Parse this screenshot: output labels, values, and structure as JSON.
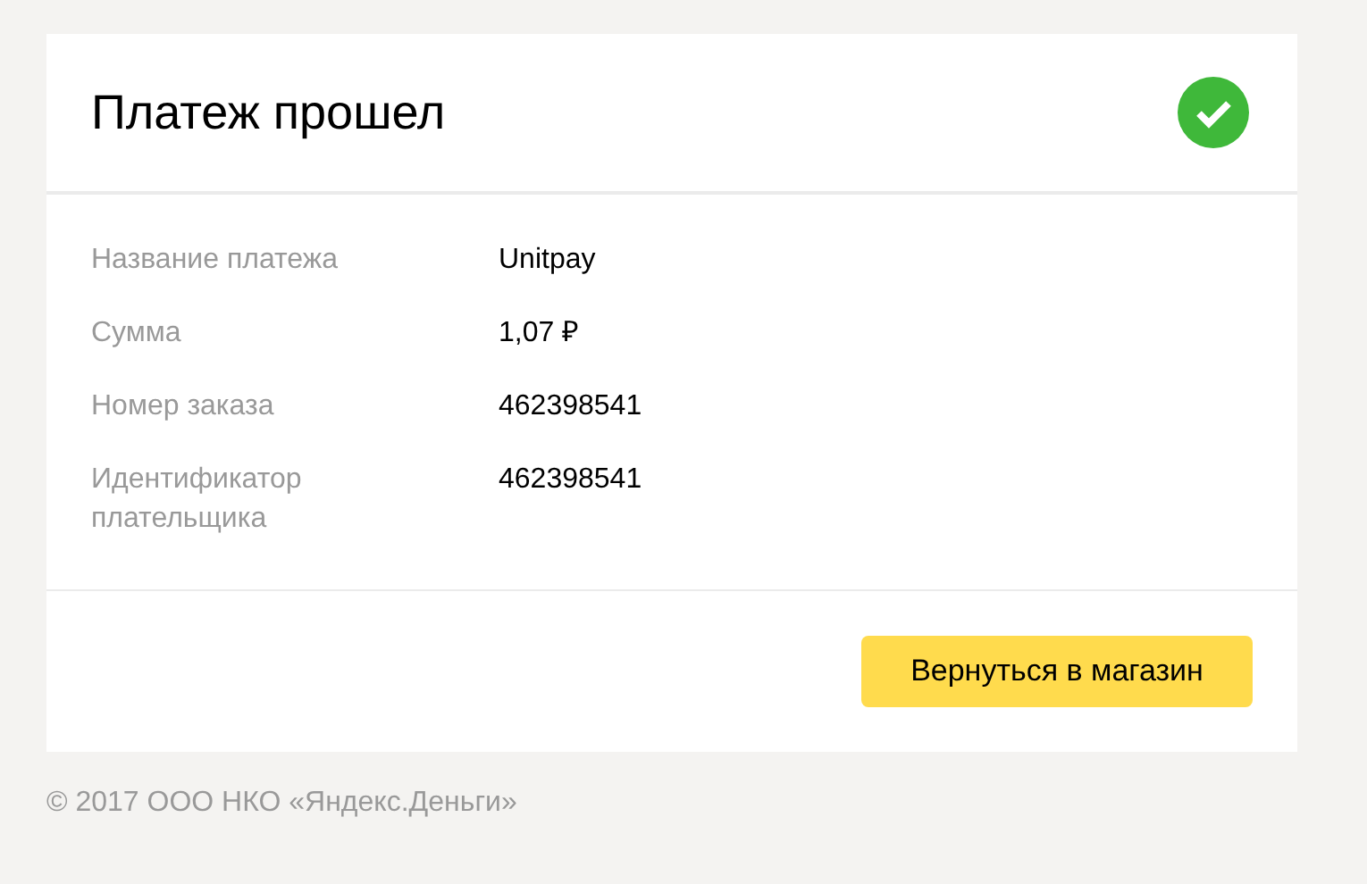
{
  "card": {
    "title": "Платеж прошел",
    "details": [
      {
        "label": "Название платежа",
        "value": "Unitpay"
      },
      {
        "label": "Сумма",
        "value": "1,07 ₽"
      },
      {
        "label": "Номер заказа",
        "value": "462398541"
      },
      {
        "label": "Идентификатор плательщика",
        "value": "462398541"
      }
    ],
    "button": "Вернуться в магазин"
  },
  "footer": "© 2017 ООО НКО «Яндекс.Деньги»"
}
